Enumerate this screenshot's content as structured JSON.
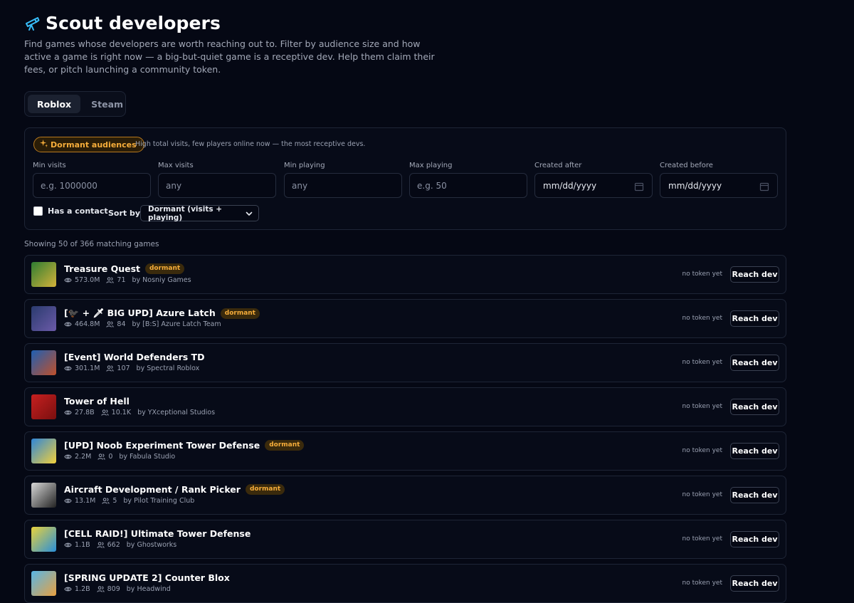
{
  "header": {
    "title": "Scout developers",
    "subtitle": "Find games whose developers are worth reaching out to. Filter by audience size and how active a game is right now — a big-but-quiet game is a receptive dev. Help them claim their fees, or pitch launching a community token."
  },
  "tabs": [
    {
      "label": "Roblox",
      "active": true
    },
    {
      "label": "Steam",
      "active": false
    }
  ],
  "filters": {
    "dormant_label": "Dormant audiences",
    "dormant_desc": "High total visits, few players online now — the most receptive devs.",
    "min_visits": {
      "label": "Min visits",
      "placeholder": "e.g. 1000000"
    },
    "max_visits": {
      "label": "Max visits",
      "placeholder": "any"
    },
    "min_playing": {
      "label": "Min playing",
      "placeholder": "any"
    },
    "max_playing": {
      "label": "Max playing",
      "placeholder": "e.g. 50"
    },
    "created_after": {
      "label": "Created after",
      "value": "mm/dd/yyyy"
    },
    "created_before": {
      "label": "Created before",
      "value": "mm/dd/yyyy"
    },
    "has_contact_label": "Has a contact",
    "sort_label": "Sort by",
    "sort_value": "Dormant (visits + playing)"
  },
  "results_count": "Showing 50 of 366 matching games",
  "games": [
    {
      "title": "Treasure Quest",
      "dormant": true,
      "visits": "573.0M",
      "playing": "71",
      "by": "by Nosniy Games",
      "token_status": "no token yet",
      "action": "Reach dev",
      "thumb": [
        "#2e7d32",
        "#d4b23a"
      ]
    },
    {
      "title": "[🐦‍⬛ + 🗡 BIG UPD] Azure Latch",
      "dormant": true,
      "visits": "464.8M",
      "playing": "84",
      "by": "by [B:S] Azure Latch Team",
      "token_status": "no token yet",
      "action": "Reach dev",
      "thumb": [
        "#2a3b6e",
        "#6b5aa8"
      ]
    },
    {
      "title": "[Event] World Defenders TD",
      "dormant": false,
      "visits": "301.1M",
      "playing": "107",
      "by": "by Spectral Roblox",
      "token_status": "no token yet",
      "action": "Reach dev",
      "thumb": [
        "#1e5fb3",
        "#c0502a"
      ]
    },
    {
      "title": "Tower of Hell",
      "dormant": false,
      "visits": "27.8B",
      "playing": "10.1K",
      "by": "by YXceptional Studios",
      "token_status": "no token yet",
      "action": "Reach dev",
      "thumb": [
        "#c62020",
        "#7a0f0f"
      ]
    },
    {
      "title": "[UPD] Noob Experiment Tower Defense",
      "dormant": true,
      "visits": "2.2M",
      "playing": "0",
      "by": "by Fabula Studio",
      "token_status": "no token yet",
      "action": "Reach dev",
      "thumb": [
        "#2f86d8",
        "#f2d03b"
      ]
    },
    {
      "title": "Aircraft Development / Rank Picker",
      "dormant": true,
      "visits": "13.1M",
      "playing": "5",
      "by": "by Pilot Training Club",
      "token_status": "no token yet",
      "action": "Reach dev",
      "thumb": [
        "#d8d8d8",
        "#222222"
      ]
    },
    {
      "title": "[CELL RAID!] Ultimate Tower Defense",
      "dormant": false,
      "visits": "1.1B",
      "playing": "662",
      "by": "by Ghostworks",
      "token_status": "no token yet",
      "action": "Reach dev",
      "thumb": [
        "#e9d23c",
        "#2a8fd8"
      ]
    },
    {
      "title": "[SPRING UPDATE 2] Counter Blox",
      "dormant": false,
      "visits": "1.2B",
      "playing": "809",
      "by": "by Headwind",
      "token_status": "no token yet",
      "action": "Reach dev",
      "thumb": [
        "#58b7e8",
        "#e8a040"
      ]
    }
  ],
  "dormant_badge": "dormant",
  "colors": {
    "background": "#050814",
    "accent": "#f6ad3a",
    "border": "#1e2536"
  },
  "icons": {
    "title": "telescope-icon",
    "dormant": "sparkles-icon",
    "visits": "eye-icon",
    "playing": "users-icon",
    "date": "calendar-icon",
    "sort": "chevron-down-icon"
  }
}
